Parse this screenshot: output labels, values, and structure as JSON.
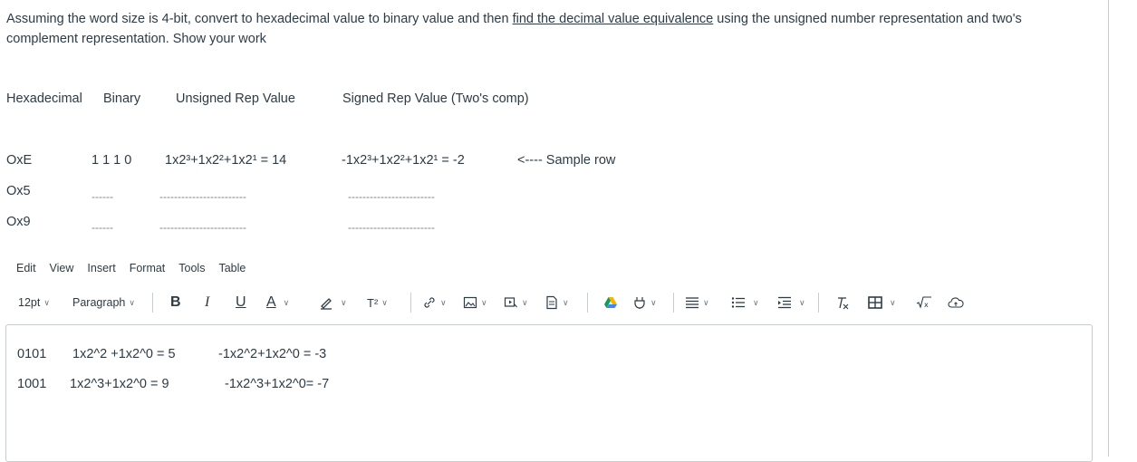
{
  "question": {
    "before": "Assuming the word size is 4-bit, convert to hexadecimal value to binary value and then ",
    "underlined": "find the decimal value equivalence",
    "after_line1": " using the unsigned number representation and two's",
    "line2": "complement representation. Show your work"
  },
  "table": {
    "headers": [
      "Hexadecimal",
      "Binary",
      "Unsigned Rep Value",
      "Signed Rep Value (Two's comp)"
    ],
    "sample": {
      "hex": "OxE",
      "binary": "1 1 1 0",
      "unsigned": "1x2³+1x2²+1x2¹  = 14",
      "signed": "-1x2³+1x2²+1x2¹  = -2",
      "note": "<---- Sample row"
    },
    "rows": [
      {
        "hex": "Ox5",
        "binary": "------",
        "unsigned": "------------------------",
        "signed": "------------------------"
      },
      {
        "hex": "Ox9",
        "binary": "------",
        "unsigned": "------------------------",
        "signed": "------------------------"
      }
    ]
  },
  "menubar": [
    "Edit",
    "View",
    "Insert",
    "Format",
    "Tools",
    "Table"
  ],
  "toolbar": {
    "font_size": "12pt",
    "block_format": "Paragraph",
    "bold": "B",
    "italic": "I",
    "underline": "U",
    "text_color": "A",
    "superscript": "T²"
  },
  "editor": {
    "line1": {
      "binary": "0101",
      "unsigned": "1x2^2 +1x2^0 = 5",
      "signed": "-1x2^2+1x2^0 = -3"
    },
    "line2": {
      "binary": "1001",
      "unsigned": "1x2^3+1x2^0 = 9",
      "signed": "-1x2^3+1x2^0= -7"
    }
  }
}
